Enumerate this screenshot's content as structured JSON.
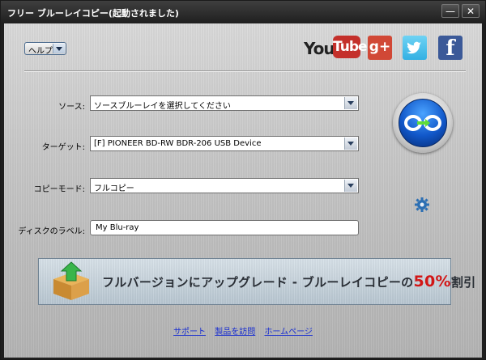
{
  "window": {
    "title": "フリー ブルーレイコピー(起動されました)",
    "minimize": "—",
    "close": "✕"
  },
  "toolbar": {
    "help_label": "ヘルプ",
    "youtube_you": "You",
    "youtube_tube": "Tube",
    "gplus": "g+",
    "facebook": "f"
  },
  "form": {
    "source_label": "ソース:",
    "source_value": "ソースブルーレイを選択してください",
    "target_label": "ターゲット:",
    "target_value": "[F] PIONEER BD-RW   BDR-206 USB Device",
    "mode_label": "コピーモード:",
    "mode_value": "フルコピー",
    "disc_label_label": "ディスクのラベル:",
    "disc_label_value": "My Blu-ray"
  },
  "banner": {
    "text_before": "フルバージョンにアップグレード - ブルーレイコピーの",
    "percent": "50%",
    "text_after": "割引"
  },
  "footer": {
    "support": "サポート",
    "visit_product": "製品を訪問",
    "homepage": "ホームページ"
  },
  "colors": {
    "titlebar": "#2b2b2b",
    "accent_red": "#d21616",
    "link_blue": "#1a2fd0",
    "copy_button_blue": "#1157c9"
  }
}
